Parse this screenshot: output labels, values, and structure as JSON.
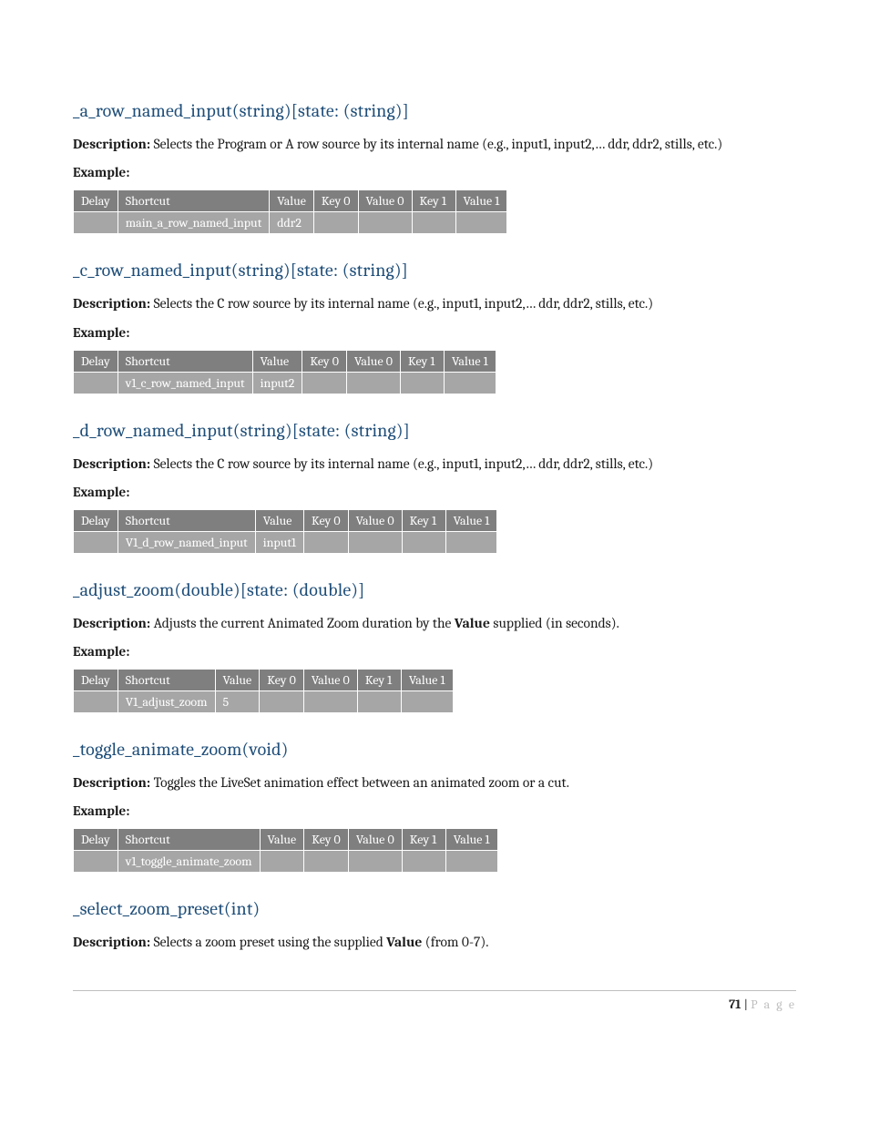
{
  "labels": {
    "description": "Description:",
    "example": "Example:",
    "th_delay": "Delay",
    "th_shortcut": "Shortcut",
    "th_value": "Value",
    "th_key0": "Key 0",
    "th_value0": "Value 0",
    "th_key1": "Key 1",
    "th_value1": "Value 1"
  },
  "sections": [
    {
      "title": "_a_row_named_input(string)[state: (string)]",
      "desc_pre": "Selects the Program or A row source by its internal name (e.g., input1, input2,… ddr, ddr2, stills, etc.)",
      "desc_bold": "",
      "desc_post": "",
      "row": {
        "shortcut": "main_a_row_named_input",
        "value": "ddr2"
      }
    },
    {
      "title": "_c_row_named_input(string)[state: (string)]",
      "desc_pre": "Selects the C row source by its internal name (e.g., input1, input2,… ddr, ddr2, stills, etc.)",
      "desc_bold": "",
      "desc_post": "",
      "row": {
        "shortcut": "v1_c_row_named_input",
        "value": "input2"
      }
    },
    {
      "title": "_d_row_named_input(string)[state: (string)]",
      "desc_pre": "Selects the C row source by its internal name (e.g., input1, input2,… ddr, ddr2, stills, etc.)",
      "desc_bold": "",
      "desc_post": "",
      "row": {
        "shortcut": "V1_d_row_named_input",
        "value": "input1"
      }
    },
    {
      "title": "_adjust_zoom(double)[state: (double)]",
      "desc_pre": "Adjusts the current Animated Zoom duration by the ",
      "desc_bold": "Value",
      "desc_post": " supplied (in seconds).",
      "row": {
        "shortcut": "V1_adjust_zoom",
        "value": "5"
      }
    },
    {
      "title": "_toggle_animate_zoom(void)",
      "desc_pre": "Toggles the LiveSet animation effect between an animated zoom or a cut.",
      "desc_bold": "",
      "desc_post": "",
      "row": {
        "shortcut": "v1_toggle_animate_zoom",
        "value": ""
      }
    },
    {
      "title": "_select_zoom_preset(int)",
      "desc_pre": "Selects a zoom preset using the supplied ",
      "desc_bold": "Value",
      "desc_post": " (from 0-7).",
      "no_table": true
    }
  ],
  "footer": {
    "page_number": "71",
    "sep": " | ",
    "page_label": "P a g e"
  }
}
